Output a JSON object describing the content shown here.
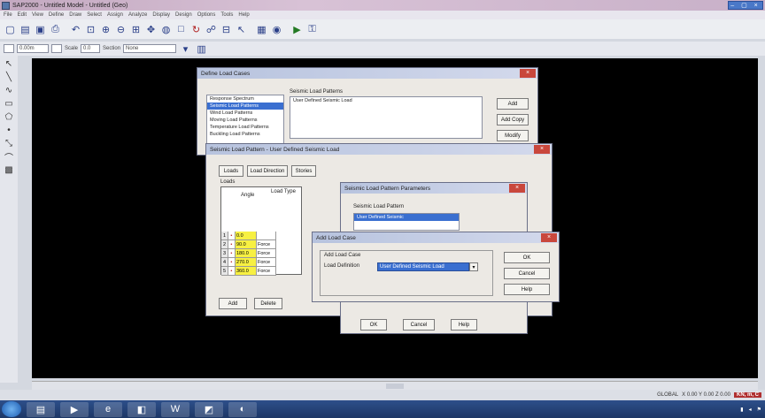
{
  "window": {
    "title": "SAP2000 - Untitled Model - Untitled (Geo)",
    "controls": "– ▢ ×"
  },
  "menu": [
    "File",
    "Edit",
    "View",
    "Define",
    "Draw",
    "Select",
    "Assign",
    "Analyze",
    "Display",
    "Design",
    "Options",
    "Tools",
    "Help"
  ],
  "toolbar2": {
    "zoom_value": "0.00m",
    "scale_label": "Scale",
    "scale_value": "0.0",
    "section_label": "Section",
    "section_value": "None"
  },
  "status": {
    "text": "GLOBAL",
    "coords": "X 0.00  Y 0.00  Z 0.00",
    "units": "KN, m, C"
  },
  "dlg_main": {
    "title": "Define Load Cases",
    "tree_items": [
      "Response Spectrum",
      "Seismic Load Patterns",
      "Wind Load Patterns",
      "Moving Load Patterns",
      "Temperature Load Patterns",
      "Buckling Load Patterns"
    ],
    "group_label": "Seismic Load Patterns",
    "list_items": [
      "User Defined Seismic Load"
    ],
    "btn_add": "Add",
    "btn_add_copy": "Add Copy",
    "btn_modify": "Modify"
  },
  "dlg_lateral": {
    "title": "Seismic Load Pattern - User Defined Seismic Load",
    "tabs": [
      "Loads",
      "Load Direction",
      "Stories"
    ],
    "group_label": "Loads",
    "col_angle": "Angle",
    "col_type": "Load Type",
    "rows": [
      {
        "idx": "1",
        "angle": "0.0",
        "type": ""
      },
      {
        "idx": "2",
        "angle": "90.0",
        "type": "Force"
      },
      {
        "idx": "3",
        "angle": "180.0",
        "type": "Force"
      },
      {
        "idx": "4",
        "angle": "270.0",
        "type": "Force"
      },
      {
        "idx": "5",
        "angle": "360.0",
        "type": "Force"
      }
    ],
    "btn_add": "Add",
    "btn_delete": "Delete"
  },
  "dlg_pattern": {
    "title": "Seismic Load Pattern Parameters",
    "group_label": "Seismic Load Pattern",
    "list_items": [
      "User Defined Seismic"
    ],
    "btn_ok": "OK",
    "btn_cancel": "Cancel",
    "btn_help": "Help"
  },
  "dlg_add": {
    "title": "Add Load Case",
    "group_label": "Add Load Case",
    "field_label": "Load Definition",
    "field_value": "User Defined Seismic Load",
    "btn_ok": "OK",
    "btn_cancel": "Cancel",
    "btn_help": "Help"
  }
}
